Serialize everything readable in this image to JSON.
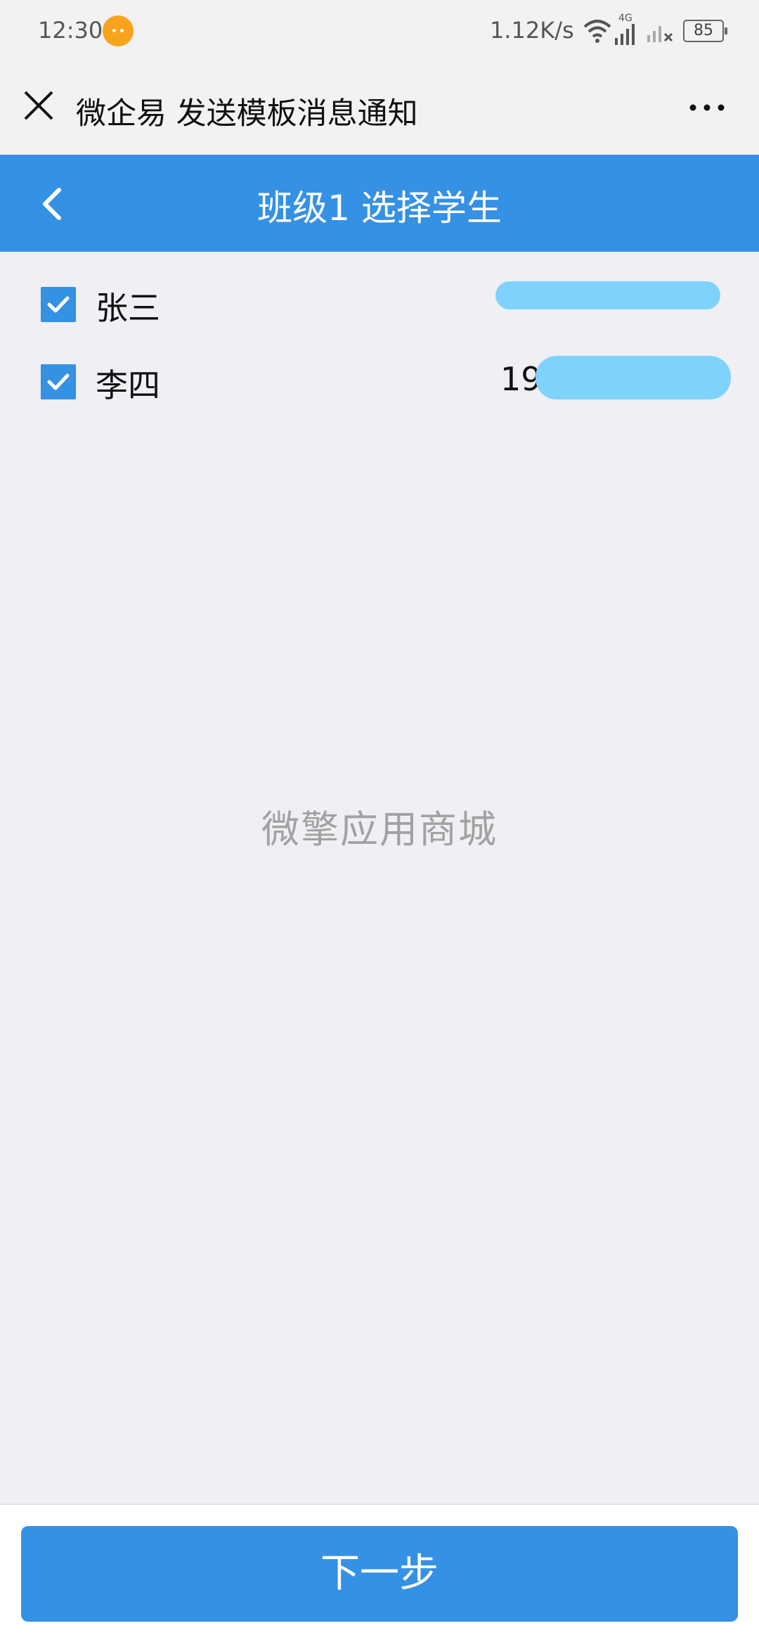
{
  "status_bar": {
    "time": "12:30",
    "net_speed": "1.12K/s",
    "network_type": "4G",
    "battery": "85"
  },
  "webview_bar": {
    "title": "微企易 发送模板消息通知"
  },
  "header": {
    "title": "班级1 选择学生"
  },
  "students": [
    {
      "name": "张三",
      "checked": true
    },
    {
      "name": "李四",
      "phone_prefix": "19",
      "checked": true
    }
  ],
  "watermark": "微擎应用商城",
  "footer": {
    "next_label": "下一步"
  },
  "colors": {
    "accent": "#3591e4",
    "background": "#efeff4",
    "redaction": "#7fd2fb"
  }
}
